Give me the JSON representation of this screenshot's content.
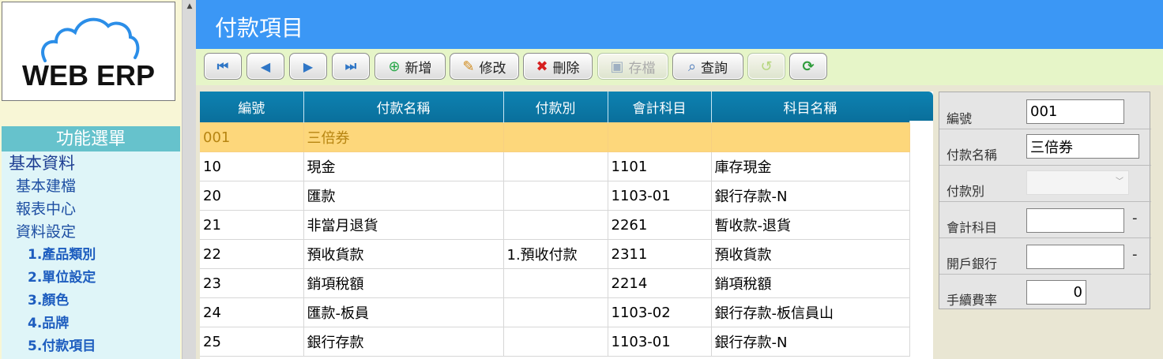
{
  "logo": {
    "text": "WEB ERP"
  },
  "menu": {
    "title": "功能選單",
    "items": [
      {
        "label": "基本資料",
        "level": 1
      },
      {
        "label": "基本建檔",
        "level": 2
      },
      {
        "label": "報表中心",
        "level": 2
      },
      {
        "label": "資料設定",
        "level": 2
      },
      {
        "label": "1.產品類別",
        "level": 3
      },
      {
        "label": "2.單位設定",
        "level": 3
      },
      {
        "label": "3.顏色",
        "level": 3
      },
      {
        "label": "4.品牌",
        "level": 3
      },
      {
        "label": "5.付款項目",
        "level": 3
      }
    ]
  },
  "page": {
    "title": "付款項目"
  },
  "toolbar": {
    "first": "first-record-icon",
    "prev": "previous-record-icon",
    "next": "next-record-icon",
    "last": "last-record-icon",
    "add_label": "新增",
    "edit_label": "修改",
    "delete_label": "刪除",
    "save_label": "存檔",
    "query_label": "查詢"
  },
  "grid": {
    "columns": [
      "編號",
      "付款名稱",
      "付款別",
      "會計科目",
      "科目名稱"
    ],
    "rows": [
      [
        "001",
        "三倍券",
        "",
        "",
        ""
      ],
      [
        "10",
        "現金",
        "",
        "1101",
        "庫存現金"
      ],
      [
        "20",
        "匯款",
        "",
        "1103-01",
        "銀行存款-N"
      ],
      [
        "21",
        "非當月退貨",
        "",
        "2261",
        "暫收款-退貨"
      ],
      [
        "22",
        "預收貨款",
        "1.預收付款",
        "2311",
        "預收貨款"
      ],
      [
        "23",
        "銷項稅額",
        "",
        "2214",
        "銷項稅額"
      ],
      [
        "24",
        "匯款-板員",
        "",
        "1103-02",
        "銀行存款-板信員山"
      ],
      [
        "25",
        "銀行存款",
        "",
        "1103-01",
        "銀行存款-N"
      ]
    ]
  },
  "form": {
    "id_label": "編號",
    "id_value": "001",
    "name_label": "付款名稱",
    "name_value": "三倍券",
    "type_label": "付款別",
    "type_value": "",
    "account_label": "會計科目",
    "account_value": "",
    "account_sep": "-",
    "bank_label": "開戶銀行",
    "bank_value": "",
    "bank_sep": "-",
    "fee_label": "手續費率",
    "fee_value": "0"
  },
  "colors": {
    "header": "#3b97f5",
    "selected_row": "#fdd77b",
    "grid_header": "#0a6f9b",
    "menu_title": "#66c2cc"
  }
}
